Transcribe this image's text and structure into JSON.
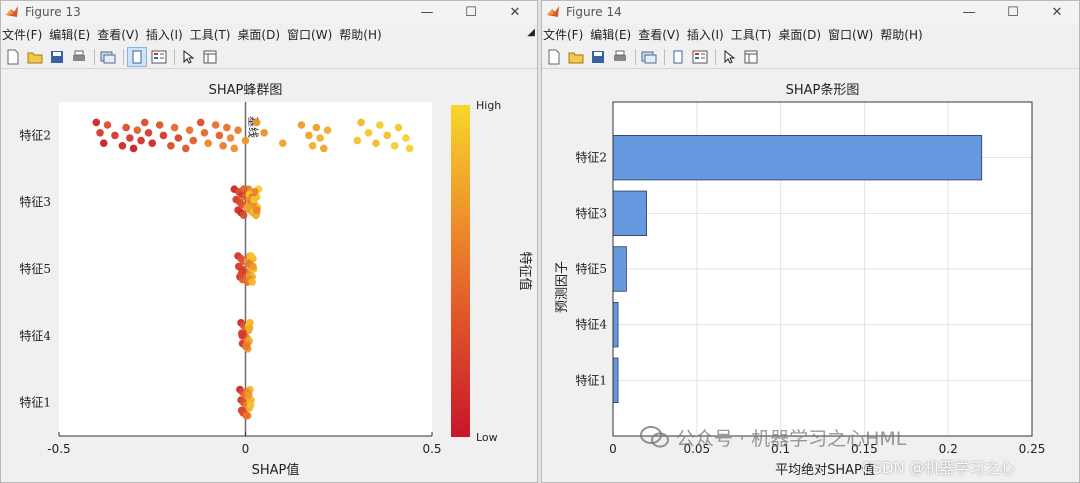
{
  "windows": {
    "left": {
      "title": "Figure 13"
    },
    "right": {
      "title": "Figure 14"
    }
  },
  "menu": [
    "文件(F)",
    "编辑(E)",
    "查看(V)",
    "插入(I)",
    "工具(T)",
    "桌面(D)",
    "窗口(W)",
    "帮助(H)"
  ],
  "toolbar_icons": [
    "new-figure-icon",
    "open-file-icon",
    "save-icon",
    "print-icon",
    "link-icon",
    "toggle-plot-icon",
    "insert-legend-icon",
    "pointer-icon",
    "property-editor-icon"
  ],
  "watermark": {
    "text": "公众号 · 机器学习之心HML",
    "sub": "CSDN @机器学习之心"
  },
  "chart_data": [
    {
      "type": "scatter",
      "title": "SHAP蜂群图",
      "xlabel": "SHAP值",
      "ylabel": "",
      "xlim": [
        -0.5,
        0.5
      ],
      "xticks": [
        -0.5,
        0,
        0.5
      ],
      "xtick_labels": [
        "-0.5",
        "0",
        "0.5"
      ],
      "categories": [
        "特征2",
        "特征3",
        "特征5",
        "特征4",
        "特征1"
      ],
      "zero_line_label": "基线",
      "colorbar": {
        "label": "特征值",
        "high": "High",
        "low": "Low",
        "low_color": "#c8152a",
        "mid_color": "#e8702a",
        "high_color": "#f7d72a"
      },
      "series": [
        {
          "category": "特征2",
          "points": [
            [
              -0.4,
              0.1
            ],
            [
              -0.39,
              0.2
            ],
            [
              -0.38,
              0.05
            ],
            [
              -0.37,
              0.3
            ],
            [
              -0.35,
              0.2
            ],
            [
              -0.33,
              0.1
            ],
            [
              -0.32,
              0.3
            ],
            [
              -0.31,
              0.2
            ],
            [
              -0.3,
              0.05
            ],
            [
              -0.29,
              0.4
            ],
            [
              -0.28,
              0.15
            ],
            [
              -0.27,
              0.3
            ],
            [
              -0.26,
              0.2
            ],
            [
              -0.25,
              0.1
            ],
            [
              -0.23,
              0.35
            ],
            [
              -0.22,
              0.2
            ],
            [
              -0.2,
              0.3
            ],
            [
              -0.19,
              0.45
            ],
            [
              -0.18,
              0.25
            ],
            [
              -0.16,
              0.35
            ],
            [
              -0.15,
              0.5
            ],
            [
              -0.14,
              0.4
            ],
            [
              -0.12,
              0.3
            ],
            [
              -0.11,
              0.45
            ],
            [
              -0.1,
              0.6
            ],
            [
              -0.08,
              0.5
            ],
            [
              -0.07,
              0.4
            ],
            [
              -0.06,
              0.55
            ],
            [
              -0.05,
              0.5
            ],
            [
              -0.04,
              0.6
            ],
            [
              -0.03,
              0.65
            ],
            [
              -0.02,
              0.55
            ],
            [
              0.0,
              0.7
            ],
            [
              0.03,
              0.7
            ],
            [
              0.05,
              0.65
            ],
            [
              0.1,
              0.75
            ],
            [
              0.15,
              0.7
            ],
            [
              0.17,
              0.75
            ],
            [
              0.18,
              0.8
            ],
            [
              0.19,
              0.72
            ],
            [
              0.2,
              0.8
            ],
            [
              0.21,
              0.75
            ],
            [
              0.22,
              0.8
            ],
            [
              0.3,
              0.9
            ],
            [
              0.31,
              0.85
            ],
            [
              0.33,
              0.92
            ],
            [
              0.35,
              0.88
            ],
            [
              0.36,
              0.95
            ],
            [
              0.38,
              0.9
            ],
            [
              0.4,
              0.95
            ],
            [
              0.41,
              0.92
            ],
            [
              0.43,
              0.98
            ],
            [
              0.44,
              0.95
            ]
          ]
        },
        {
          "category": "特征3",
          "points": [
            [
              -0.03,
              0.1
            ],
            [
              -0.025,
              0.2
            ],
            [
              -0.02,
              0.15
            ],
            [
              -0.018,
              0.3
            ],
            [
              -0.015,
              0.25
            ],
            [
              -0.012,
              0.1
            ],
            [
              -0.01,
              0.2
            ],
            [
              -0.008,
              0.35
            ],
            [
              -0.005,
              0.3
            ],
            [
              0.0,
              0.4
            ],
            [
              0.005,
              0.5
            ],
            [
              0.008,
              0.55
            ],
            [
              0.01,
              0.6
            ],
            [
              0.012,
              0.65
            ],
            [
              0.015,
              0.7
            ],
            [
              0.018,
              0.75
            ],
            [
              0.02,
              0.8
            ],
            [
              0.022,
              0.78
            ],
            [
              0.025,
              0.85
            ],
            [
              0.028,
              0.9
            ],
            [
              0.03,
              0.88
            ],
            [
              0.032,
              0.92
            ],
            [
              0.035,
              0.95
            ],
            [
              0.012,
              0.7
            ],
            [
              0.02,
              0.85
            ],
            [
              0.025,
              0.6
            ],
            [
              0.015,
              0.5
            ],
            [
              0.03,
              0.7
            ],
            [
              0.01,
              0.9
            ],
            [
              0.02,
              0.65
            ],
            [
              0.028,
              0.8
            ],
            [
              0.018,
              0.55
            ],
            [
              0.005,
              0.75
            ],
            [
              -0.005,
              0.4
            ],
            [
              0.022,
              0.9
            ],
            [
              0.03,
              0.6
            ]
          ]
        },
        {
          "category": "特征5",
          "points": [
            [
              -0.02,
              0.15
            ],
            [
              -0.018,
              0.2
            ],
            [
              -0.015,
              0.1
            ],
            [
              -0.012,
              0.3
            ],
            [
              -0.01,
              0.25
            ],
            [
              -0.008,
              0.4
            ],
            [
              -0.005,
              0.35
            ],
            [
              0.0,
              0.45
            ],
            [
              0.005,
              0.5
            ],
            [
              0.008,
              0.6
            ],
            [
              0.01,
              0.65
            ],
            [
              0.012,
              0.7
            ],
            [
              0.015,
              0.75
            ],
            [
              0.018,
              0.8
            ],
            [
              0.02,
              0.85
            ],
            [
              0.022,
              0.9
            ],
            [
              0.012,
              0.6
            ],
            [
              0.005,
              0.7
            ],
            [
              -0.008,
              0.2
            ],
            [
              0.018,
              0.85
            ],
            [
              0.01,
              0.55
            ],
            [
              -0.012,
              0.3
            ],
            [
              0.015,
              0.9
            ],
            [
              0.02,
              0.7
            ]
          ]
        },
        {
          "category": "特征4",
          "points": [
            [
              -0.012,
              0.1
            ],
            [
              -0.01,
              0.2
            ],
            [
              -0.008,
              0.15
            ],
            [
              -0.005,
              0.3
            ],
            [
              -0.002,
              0.4
            ],
            [
              0.0,
              0.45
            ],
            [
              0.002,
              0.5
            ],
            [
              0.004,
              0.6
            ],
            [
              0.006,
              0.7
            ],
            [
              0.008,
              0.75
            ],
            [
              0.01,
              0.8
            ],
            [
              0.012,
              0.85
            ],
            [
              -0.006,
              0.25
            ],
            [
              0.005,
              0.65
            ],
            [
              0.009,
              0.9
            ],
            [
              -0.009,
              0.2
            ],
            [
              0.003,
              0.55
            ],
            [
              0.011,
              0.8
            ]
          ]
        },
        {
          "category": "特征1",
          "points": [
            [
              -0.015,
              0.1
            ],
            [
              -0.012,
              0.2
            ],
            [
              -0.01,
              0.15
            ],
            [
              -0.008,
              0.3
            ],
            [
              -0.005,
              0.35
            ],
            [
              -0.002,
              0.4
            ],
            [
              0.0,
              0.5
            ],
            [
              0.003,
              0.55
            ],
            [
              0.006,
              0.65
            ],
            [
              0.008,
              0.7
            ],
            [
              0.01,
              0.75
            ],
            [
              0.012,
              0.85
            ],
            [
              0.015,
              0.9
            ],
            [
              -0.01,
              0.25
            ],
            [
              0.005,
              0.6
            ],
            [
              0.012,
              0.8
            ],
            [
              -0.006,
              0.3
            ],
            [
              0.009,
              0.7
            ],
            [
              0.014,
              0.9
            ],
            [
              0.002,
              0.5
            ]
          ]
        }
      ]
    },
    {
      "type": "bar",
      "orientation": "horizontal",
      "title": "SHAP条形图",
      "xlabel": "平均绝对SHAP值",
      "ylabel": "预测因子",
      "xlim": [
        0,
        0.25
      ],
      "xticks": [
        0,
        0.05,
        0.1,
        0.15,
        0.2,
        0.25
      ],
      "xtick_labels": [
        "0",
        "0.05",
        "0.1",
        "0.15",
        "0.2",
        "0.25"
      ],
      "grid": true,
      "categories": [
        "特征2",
        "特征3",
        "特征5",
        "特征4",
        "特征1"
      ],
      "values": [
        0.22,
        0.02,
        0.008,
        0.003,
        0.003
      ],
      "bar_color": "#6699e0"
    }
  ]
}
